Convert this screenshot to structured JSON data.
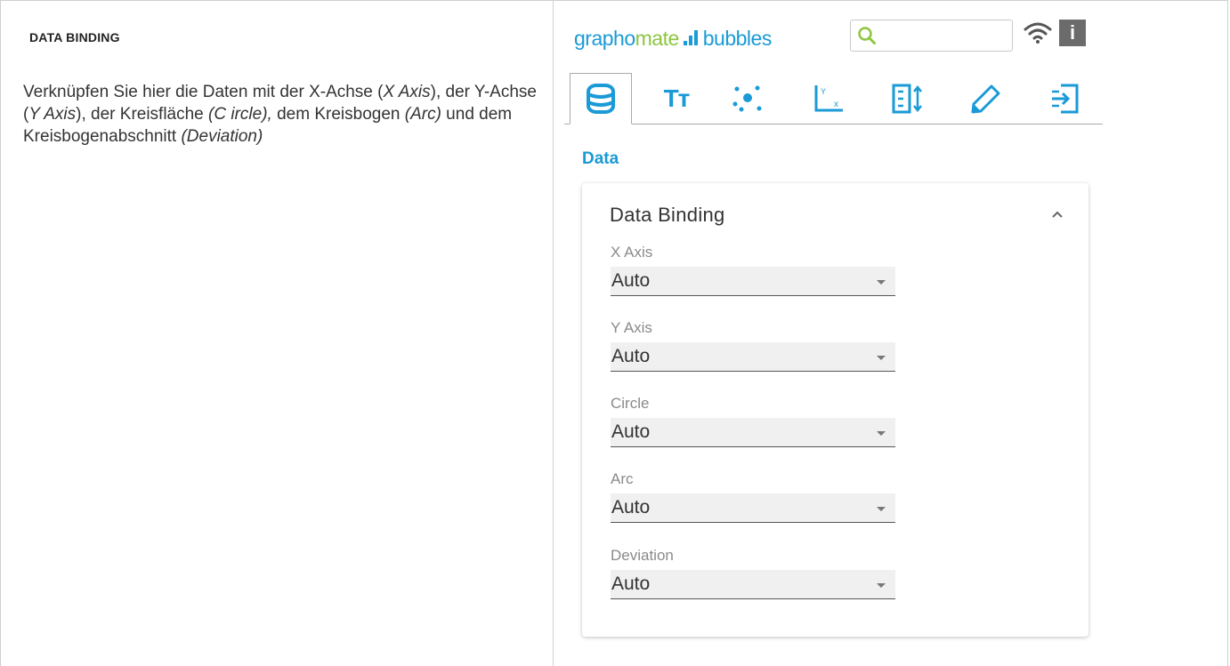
{
  "doc": {
    "heading": "DATA BINDING",
    "text_1": "Verknüpfen Sie hier die Daten mit der X-Achse (",
    "x_axis": "X Axis",
    "text_2": "), der Y-Achse (",
    "y_axis": "Y Axis",
    "text_3": "), der Kreisfläche ",
    "circle": "(C ircle),",
    "text_4": " dem Kreisbogen ",
    "arc": "(Arc)",
    "text_5": " und dem Kreisbogenabschnitt ",
    "deviation": "(Deviation)"
  },
  "header": {
    "brand_part1": "grapho",
    "brand_part2": "mate",
    "brand_part3": "bubbles",
    "search_value": "",
    "info_label": "i",
    "text_tab_label": "Tт"
  },
  "tabs": [
    {
      "icon": "database-icon",
      "active": true
    },
    {
      "icon": "text-icon",
      "active": false
    },
    {
      "icon": "bubbles-icon",
      "active": false
    },
    {
      "icon": "axis-icon",
      "active": false
    },
    {
      "icon": "list-sort-icon",
      "active": false
    },
    {
      "icon": "pencil-icon",
      "active": false
    },
    {
      "icon": "import-icon",
      "active": false
    }
  ],
  "section_title": "Data",
  "card": {
    "title": "Data Binding",
    "fields": [
      {
        "label": "X Axis",
        "value": "Auto"
      },
      {
        "label": "Y Axis",
        "value": "Auto"
      },
      {
        "label": "Circle",
        "value": "Auto"
      },
      {
        "label": "Arc",
        "value": "Auto"
      },
      {
        "label": "Deviation",
        "value": "Auto"
      }
    ]
  },
  "colors": {
    "accent_blue": "#1a9ad6",
    "accent_green": "#8dc63f",
    "info_gray": "#6b6b6b"
  }
}
